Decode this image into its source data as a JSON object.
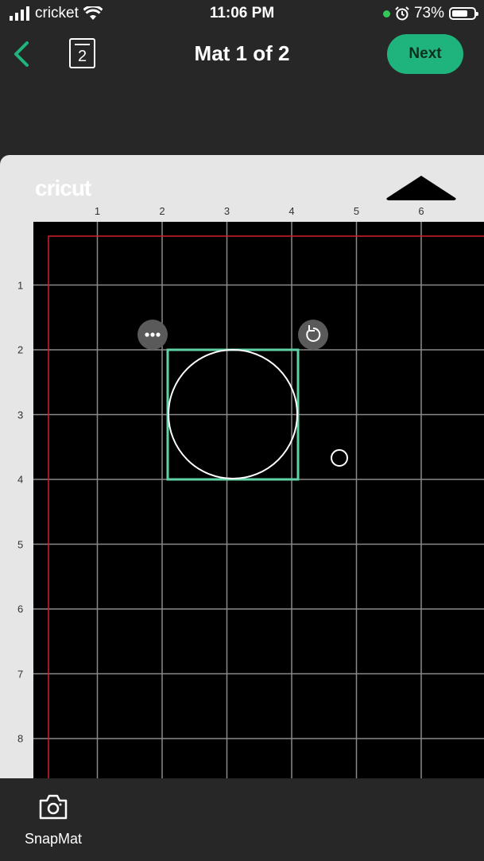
{
  "status_bar": {
    "carrier": "cricket",
    "time": "11:06 PM",
    "battery_percent": "73%",
    "battery_level": 0.73
  },
  "header": {
    "mat_number": "2",
    "title": "Mat 1 of 2",
    "next_label": "Next"
  },
  "mat": {
    "logo": "cricut",
    "ruler_top": [
      "1",
      "2",
      "3",
      "4",
      "5",
      "6"
    ],
    "ruler_left": [
      "1",
      "2",
      "3",
      "4",
      "5",
      "6",
      "7",
      "8"
    ]
  },
  "bottom": {
    "snapmat_label": "SnapMat"
  },
  "colors": {
    "accent": "#1fb47e",
    "selection": "#5fd3a6",
    "cut_margin": "#d61f2c",
    "grid_line": "#8a8a8a"
  }
}
